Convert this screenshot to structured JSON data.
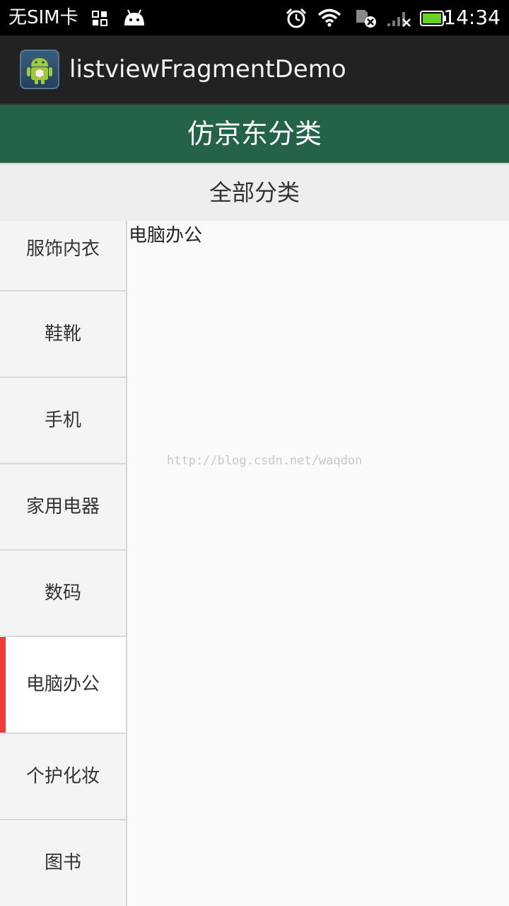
{
  "status_bar": {
    "carrier": "无SIM卡",
    "time": "14:34",
    "icons": [
      "grid-icon",
      "android-notification-icon",
      "alarm-icon",
      "wifi-icon",
      "sim-error-icon",
      "signal-icon",
      "battery-icon"
    ],
    "battery_color": "#6ad128"
  },
  "action_bar": {
    "app_name": "listviewFragmentDemo",
    "icon": "android-app-icon"
  },
  "title_bar": {
    "title": "仿京东分类",
    "background": "#246348"
  },
  "sub_header": {
    "label": "全部分类"
  },
  "categories": [
    {
      "label": "服饰内衣",
      "selected": false
    },
    {
      "label": "鞋靴",
      "selected": false
    },
    {
      "label": "手机",
      "selected": false
    },
    {
      "label": "家用电器",
      "selected": false
    },
    {
      "label": "数码",
      "selected": false
    },
    {
      "label": "电脑办公",
      "selected": true
    },
    {
      "label": "个护化妆",
      "selected": false
    },
    {
      "label": "图书",
      "selected": false
    }
  ],
  "selected_accent": "#ee3b3b",
  "content": {
    "text": "电脑办公"
  },
  "watermark": "http://blog.csdn.net/waqdon"
}
